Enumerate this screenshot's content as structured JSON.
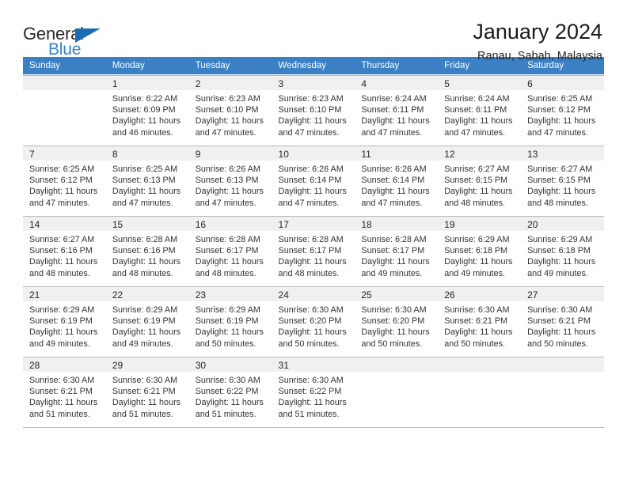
{
  "brand": {
    "name_part1": "General",
    "name_part2": "Blue",
    "flag_icon": "triangle-flag-icon",
    "accent_color": "#2e84c8",
    "header_color": "#3b80c4"
  },
  "header": {
    "title": "January 2024",
    "subtitle": "Ranau, Sabah, Malaysia"
  },
  "calendar": {
    "weekday_headers": [
      "Sunday",
      "Monday",
      "Tuesday",
      "Wednesday",
      "Thursday",
      "Friday",
      "Saturday"
    ],
    "weeks": [
      [
        {
          "day": "",
          "sunrise": "",
          "sunset": "",
          "daylight1": "",
          "daylight2": ""
        },
        {
          "day": "1",
          "sunrise": "Sunrise: 6:22 AM",
          "sunset": "Sunset: 6:09 PM",
          "daylight1": "Daylight: 11 hours",
          "daylight2": "and 46 minutes."
        },
        {
          "day": "2",
          "sunrise": "Sunrise: 6:23 AM",
          "sunset": "Sunset: 6:10 PM",
          "daylight1": "Daylight: 11 hours",
          "daylight2": "and 47 minutes."
        },
        {
          "day": "3",
          "sunrise": "Sunrise: 6:23 AM",
          "sunset": "Sunset: 6:10 PM",
          "daylight1": "Daylight: 11 hours",
          "daylight2": "and 47 minutes."
        },
        {
          "day": "4",
          "sunrise": "Sunrise: 6:24 AM",
          "sunset": "Sunset: 6:11 PM",
          "daylight1": "Daylight: 11 hours",
          "daylight2": "and 47 minutes."
        },
        {
          "day": "5",
          "sunrise": "Sunrise: 6:24 AM",
          "sunset": "Sunset: 6:11 PM",
          "daylight1": "Daylight: 11 hours",
          "daylight2": "and 47 minutes."
        },
        {
          "day": "6",
          "sunrise": "Sunrise: 6:25 AM",
          "sunset": "Sunset: 6:12 PM",
          "daylight1": "Daylight: 11 hours",
          "daylight2": "and 47 minutes."
        }
      ],
      [
        {
          "day": "7",
          "sunrise": "Sunrise: 6:25 AM",
          "sunset": "Sunset: 6:12 PM",
          "daylight1": "Daylight: 11 hours",
          "daylight2": "and 47 minutes."
        },
        {
          "day": "8",
          "sunrise": "Sunrise: 6:25 AM",
          "sunset": "Sunset: 6:13 PM",
          "daylight1": "Daylight: 11 hours",
          "daylight2": "and 47 minutes."
        },
        {
          "day": "9",
          "sunrise": "Sunrise: 6:26 AM",
          "sunset": "Sunset: 6:13 PM",
          "daylight1": "Daylight: 11 hours",
          "daylight2": "and 47 minutes."
        },
        {
          "day": "10",
          "sunrise": "Sunrise: 6:26 AM",
          "sunset": "Sunset: 6:14 PM",
          "daylight1": "Daylight: 11 hours",
          "daylight2": "and 47 minutes."
        },
        {
          "day": "11",
          "sunrise": "Sunrise: 6:26 AM",
          "sunset": "Sunset: 6:14 PM",
          "daylight1": "Daylight: 11 hours",
          "daylight2": "and 47 minutes."
        },
        {
          "day": "12",
          "sunrise": "Sunrise: 6:27 AM",
          "sunset": "Sunset: 6:15 PM",
          "daylight1": "Daylight: 11 hours",
          "daylight2": "and 48 minutes."
        },
        {
          "day": "13",
          "sunrise": "Sunrise: 6:27 AM",
          "sunset": "Sunset: 6:15 PM",
          "daylight1": "Daylight: 11 hours",
          "daylight2": "and 48 minutes."
        }
      ],
      [
        {
          "day": "14",
          "sunrise": "Sunrise: 6:27 AM",
          "sunset": "Sunset: 6:16 PM",
          "daylight1": "Daylight: 11 hours",
          "daylight2": "and 48 minutes."
        },
        {
          "day": "15",
          "sunrise": "Sunrise: 6:28 AM",
          "sunset": "Sunset: 6:16 PM",
          "daylight1": "Daylight: 11 hours",
          "daylight2": "and 48 minutes."
        },
        {
          "day": "16",
          "sunrise": "Sunrise: 6:28 AM",
          "sunset": "Sunset: 6:17 PM",
          "daylight1": "Daylight: 11 hours",
          "daylight2": "and 48 minutes."
        },
        {
          "day": "17",
          "sunrise": "Sunrise: 6:28 AM",
          "sunset": "Sunset: 6:17 PM",
          "daylight1": "Daylight: 11 hours",
          "daylight2": "and 48 minutes."
        },
        {
          "day": "18",
          "sunrise": "Sunrise: 6:28 AM",
          "sunset": "Sunset: 6:17 PM",
          "daylight1": "Daylight: 11 hours",
          "daylight2": "and 49 minutes."
        },
        {
          "day": "19",
          "sunrise": "Sunrise: 6:29 AM",
          "sunset": "Sunset: 6:18 PM",
          "daylight1": "Daylight: 11 hours",
          "daylight2": "and 49 minutes."
        },
        {
          "day": "20",
          "sunrise": "Sunrise: 6:29 AM",
          "sunset": "Sunset: 6:18 PM",
          "daylight1": "Daylight: 11 hours",
          "daylight2": "and 49 minutes."
        }
      ],
      [
        {
          "day": "21",
          "sunrise": "Sunrise: 6:29 AM",
          "sunset": "Sunset: 6:19 PM",
          "daylight1": "Daylight: 11 hours",
          "daylight2": "and 49 minutes."
        },
        {
          "day": "22",
          "sunrise": "Sunrise: 6:29 AM",
          "sunset": "Sunset: 6:19 PM",
          "daylight1": "Daylight: 11 hours",
          "daylight2": "and 49 minutes."
        },
        {
          "day": "23",
          "sunrise": "Sunrise: 6:29 AM",
          "sunset": "Sunset: 6:19 PM",
          "daylight1": "Daylight: 11 hours",
          "daylight2": "and 50 minutes."
        },
        {
          "day": "24",
          "sunrise": "Sunrise: 6:30 AM",
          "sunset": "Sunset: 6:20 PM",
          "daylight1": "Daylight: 11 hours",
          "daylight2": "and 50 minutes."
        },
        {
          "day": "25",
          "sunrise": "Sunrise: 6:30 AM",
          "sunset": "Sunset: 6:20 PM",
          "daylight1": "Daylight: 11 hours",
          "daylight2": "and 50 minutes."
        },
        {
          "day": "26",
          "sunrise": "Sunrise: 6:30 AM",
          "sunset": "Sunset: 6:21 PM",
          "daylight1": "Daylight: 11 hours",
          "daylight2": "and 50 minutes."
        },
        {
          "day": "27",
          "sunrise": "Sunrise: 6:30 AM",
          "sunset": "Sunset: 6:21 PM",
          "daylight1": "Daylight: 11 hours",
          "daylight2": "and 50 minutes."
        }
      ],
      [
        {
          "day": "28",
          "sunrise": "Sunrise: 6:30 AM",
          "sunset": "Sunset: 6:21 PM",
          "daylight1": "Daylight: 11 hours",
          "daylight2": "and 51 minutes."
        },
        {
          "day": "29",
          "sunrise": "Sunrise: 6:30 AM",
          "sunset": "Sunset: 6:21 PM",
          "daylight1": "Daylight: 11 hours",
          "daylight2": "and 51 minutes."
        },
        {
          "day": "30",
          "sunrise": "Sunrise: 6:30 AM",
          "sunset": "Sunset: 6:22 PM",
          "daylight1": "Daylight: 11 hours",
          "daylight2": "and 51 minutes."
        },
        {
          "day": "31",
          "sunrise": "Sunrise: 6:30 AM",
          "sunset": "Sunset: 6:22 PM",
          "daylight1": "Daylight: 11 hours",
          "daylight2": "and 51 minutes."
        },
        {
          "day": "",
          "sunrise": "",
          "sunset": "",
          "daylight1": "",
          "daylight2": ""
        },
        {
          "day": "",
          "sunrise": "",
          "sunset": "",
          "daylight1": "",
          "daylight2": ""
        },
        {
          "day": "",
          "sunrise": "",
          "sunset": "",
          "daylight1": "",
          "daylight2": ""
        }
      ]
    ]
  }
}
